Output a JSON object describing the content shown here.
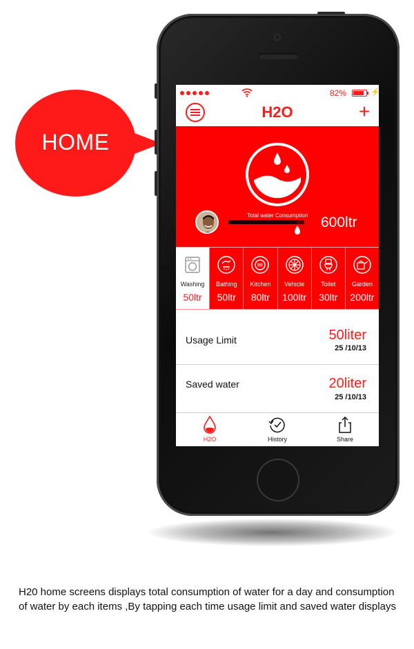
{
  "callout": {
    "label": "HOME"
  },
  "status": {
    "battery_pct": "82%",
    "battery_level": 0.82,
    "accent": "#ff1a1a"
  },
  "navbar": {
    "title": "H2O",
    "menu_icon": "menu-icon",
    "add_icon": "plus-icon",
    "add_label": "+"
  },
  "summary": {
    "label": "Total water Consumption",
    "value": "600ltr",
    "progress": 0.9
  },
  "categories": [
    {
      "name": "Washing",
      "value": "50ltr",
      "icon": "washing-machine-icon",
      "selected": true
    },
    {
      "name": "Bathing",
      "value": "50ltr",
      "icon": "bathing-icon",
      "selected": false
    },
    {
      "name": "Kitchen",
      "value": "80ltr",
      "icon": "kitchen-icon",
      "selected": false
    },
    {
      "name": "Vehicle",
      "value": "100ltr",
      "icon": "vehicle-wheel-icon",
      "selected": false
    },
    {
      "name": "Toilet",
      "value": "30ltr",
      "icon": "toilet-icon",
      "selected": false
    },
    {
      "name": "Garden",
      "value": "200ltr",
      "icon": "watering-can-icon",
      "selected": false
    }
  ],
  "usage_limit": {
    "label": "Usage Limit",
    "amount": "50liter",
    "date": "25 /10/13"
  },
  "saved_water": {
    "label": "Saved water",
    "amount": "20liter",
    "date": "25 /10/13"
  },
  "tabs": [
    {
      "label": "H2O",
      "icon": "water-drop-icon",
      "active": true
    },
    {
      "label": "History",
      "icon": "history-clock-icon",
      "active": false
    },
    {
      "label": "Share",
      "icon": "share-icon",
      "active": false
    }
  ],
  "caption": "H20 home screens displays total consumption of water for a day and consumption of water by each items ,By tapping each time usage limit and saved water displays"
}
